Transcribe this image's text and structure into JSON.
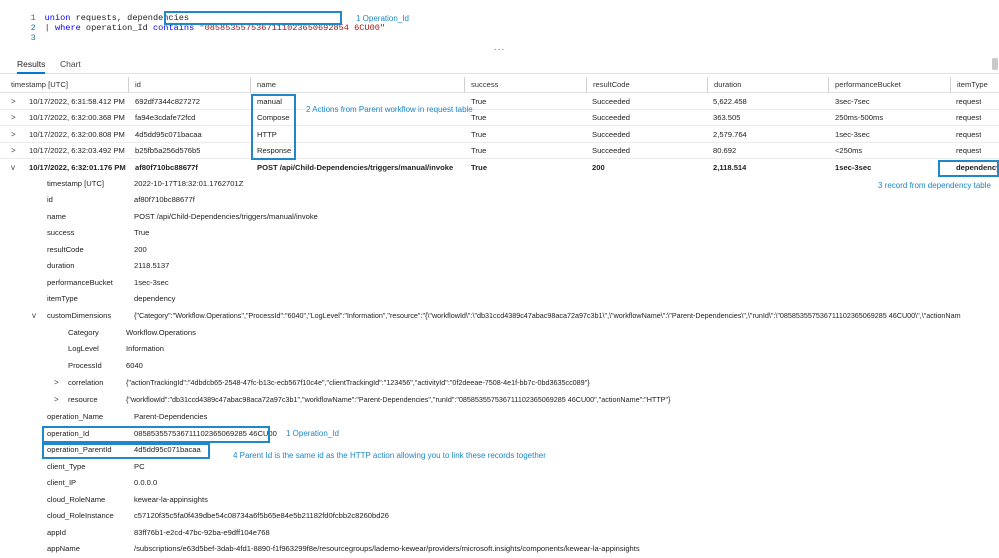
{
  "query": {
    "line_numbers": [
      "1",
      "2",
      "3"
    ],
    "line1": {
      "kw": "union",
      "rest": " requests, dependencies"
    },
    "line2": {
      "pipe": "| ",
      "kw1": "where",
      "mid": " operation_Id ",
      "kw2": "contains",
      "str": "\"0858535575367111023650692854 6CU00\""
    },
    "line3": "",
    "splitter": "..."
  },
  "tabs": [
    {
      "label": "Results",
      "active": true
    },
    {
      "label": "Chart",
      "active": false
    }
  ],
  "columns": [
    "timestamp [UTC]",
    "id",
    "name",
    "success",
    "resultCode",
    "duration",
    "performanceBucket",
    "itemType"
  ],
  "rows": [
    {
      "chevron": ">",
      "timestamp": "10/17/2022, 6:31:58.412 PM",
      "id": "692df7344c827272",
      "name": "manual",
      "success": "True",
      "resultCode": "Succeeded",
      "duration": "5,622.458",
      "performanceBucket": "3sec-7sec",
      "itemType": "request"
    },
    {
      "chevron": ">",
      "timestamp": "10/17/2022, 6:32:00.368 PM",
      "id": "fa94e3cdafe72fcd",
      "name": "Compose",
      "success": "True",
      "resultCode": "Succeeded",
      "duration": "363.505",
      "performanceBucket": "250ms-500ms",
      "itemType": "request"
    },
    {
      "chevron": ">",
      "timestamp": "10/17/2022, 6:32:00.808 PM",
      "id": "4d5dd95c071bacaa",
      "name": "HTTP",
      "success": "True",
      "resultCode": "Succeeded",
      "duration": "2,579.764",
      "performanceBucket": "1sec-3sec",
      "itemType": "request"
    },
    {
      "chevron": ">",
      "timestamp": "10/17/2022, 6:32:03.492 PM",
      "id": "b25fb5a256d576b5",
      "name": "Response",
      "success": "True",
      "resultCode": "Succeeded",
      "duration": "80.692",
      "performanceBucket": "<250ms",
      "itemType": "request"
    },
    {
      "chevron": "v",
      "timestamp": "10/17/2022, 6:32:01.176 PM",
      "id": "af80f710bc88677f",
      "name": "POST /api/Child-Dependencies/triggers/manual/invoke",
      "success": "True",
      "resultCode": "200",
      "duration": "2,118.514",
      "performanceBucket": "1sec-3sec",
      "itemType": "dependency"
    }
  ],
  "details": {
    "timestamp": {
      "name": "timestamp [UTC]",
      "value": "2022-10-17T18:32:01.1762701Z"
    },
    "id": {
      "name": "id",
      "value": "af80f710bc88677f"
    },
    "name": {
      "name": "name",
      "value": "POST /api/Child-Dependencies/triggers/manual/invoke"
    },
    "success": {
      "name": "success",
      "value": "True"
    },
    "resultCode": {
      "name": "resultCode",
      "value": "200"
    },
    "duration": {
      "name": "duration",
      "value": "2118.5137"
    },
    "performanceBucket": {
      "name": "performanceBucket",
      "value": "1sec-3sec"
    },
    "itemType": {
      "name": "itemType",
      "value": "dependency"
    },
    "customDimensions": {
      "chevron": "v",
      "name": "customDimensions",
      "value": "{\"Category\":\"Workflow.Operations\",\"ProcessId\":\"6040\",\"LogLevel\":\"Information\",\"resource\":\"{\\\"workflowId\\\":\\\"db31ccd4389c47abac98aca72a97c3b1\\\",\\\"workflowName\\\":\\\"Parent-Dependencies\\\",\\\"runId\\\":\\\"085853557536711102365069285 46CU00\\\",\\\"actionNam",
      "category": {
        "name": "Category",
        "value": "Workflow.Operations"
      },
      "loglevel": {
        "name": "LogLevel",
        "value": "Information"
      },
      "processid": {
        "name": "ProcessId",
        "value": "6040"
      },
      "correlation": {
        "chevron": ">",
        "name": "correlation",
        "value": "{\"actionTrackingId\":\"4dbdcb65-2548-47fc-b13c-ecb567f10c4e\",\"clientTrackingId\":\"123456\",\"activityId\":\"0f2deeae-7508-4e1f-bb7c-0bd3635cc089\"}"
      },
      "resource": {
        "chevron": ">",
        "name": "resource",
        "value": "{\"workflowId\":\"db31ccd4389c47abac98aca72a97c3b1\",\"workflowName\":\"Parent-Dependencies\",\"runId\":\"085853557536711102365069285 46CU00\",\"actionName\":\"HTTP\"}"
      }
    },
    "operation_Name": {
      "name": "operation_Name",
      "value": "Parent-Dependencies"
    },
    "operation_Id": {
      "name": "operation_Id",
      "value": "085853557536711102365069285 46CU00"
    },
    "operation_ParentId": {
      "name": "operation_ParentId",
      "value": "4d5dd95c071bacaa"
    },
    "client_Type": {
      "name": "client_Type",
      "value": "PC"
    },
    "client_IP": {
      "name": "client_IP",
      "value": "0.0.0.0"
    },
    "cloud_RoleName": {
      "name": "cloud_RoleName",
      "value": "kewear-la-appinsights"
    },
    "cloud_RoleInstance": {
      "name": "cloud_RoleInstance",
      "value": "c57120f35c5fa0f439dbe54c08734a6f5b65e84e5b21182fd0fcbb2c8260bd26"
    },
    "appId": {
      "name": "appId",
      "value": "83ff76b1-e2cd-47bc-92ba-e9dff104e768"
    },
    "appName": {
      "name": "appName",
      "value": "/subscriptions/e63d5bef-3dab-4fd1-8890-f1f963299f8e/resourcegroups/lademo-kewear/providers/microsoft.insights/components/kewear-la-appinsights"
    }
  },
  "annotations": {
    "note1_top": "1  Operation_Id",
    "note2": "2  Actions from Parent workflow in request table",
    "note3": "3  record from dependency table",
    "note1_bottom": "1  Operation_Id",
    "note4": "4  Parent Id is the same id as the HTTP action allowing you to link these records together"
  },
  "colors": {
    "accent": "#0078d4",
    "annotation": "#1e88c8",
    "keyword": "#0000ff",
    "string": "#a31515"
  }
}
